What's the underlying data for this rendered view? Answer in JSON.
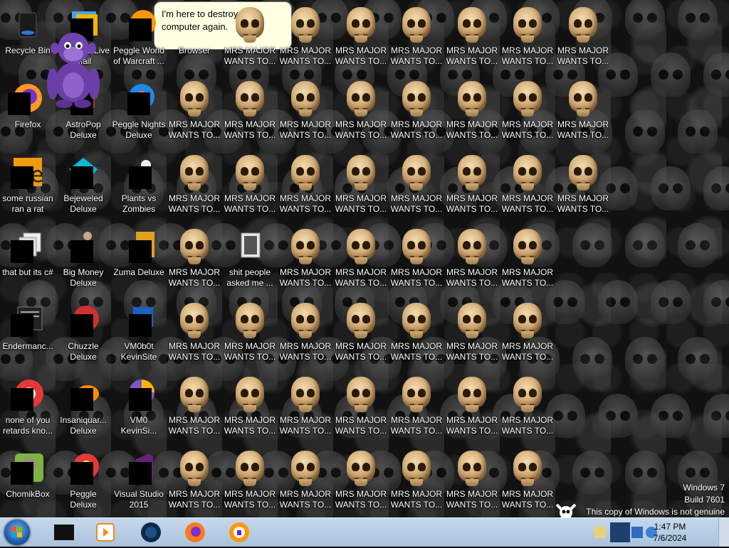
{
  "desktop": {
    "col1": [
      {
        "label": "Recycle Bin",
        "icon": "recycle-bin-icon"
      },
      {
        "label": "Firefox",
        "icon": "firefox-icon"
      },
      {
        "label": "some russian ran a rat",
        "icon": "app-e-icon"
      },
      {
        "label": "that but its c#",
        "icon": "documents-stack-icon"
      },
      {
        "label": "Endermanc...",
        "icon": "window-icon"
      },
      {
        "label": "none of you retards kno...",
        "icon": "chrome-icon"
      },
      {
        "label": "ChomikBox",
        "icon": "chomikbox-icon"
      }
    ],
    "col2": [
      {
        "label": "Windows Live Mail",
        "icon": "windows-live-mail-icon"
      },
      {
        "label": "AstroPop Deluxe",
        "icon": "astropop-icon"
      },
      {
        "label": "Bejeweled Deluxe",
        "icon": "bejeweled-icon"
      },
      {
        "label": "Big Money Deluxe",
        "icon": "big-money-icon"
      },
      {
        "label": "Chuzzle Deluxe",
        "icon": "chuzzle-icon"
      },
      {
        "label": "Insaniquar... Deluxe",
        "icon": "insaniquarium-icon"
      },
      {
        "label": "Peggle Deluxe",
        "icon": "peggle-icon"
      }
    ],
    "col3": [
      {
        "label": "Peggle World of Warcraft ...",
        "icon": "peggle-wow-icon"
      },
      {
        "label": "Peggle Nights Deluxe",
        "icon": "peggle-nights-icon"
      },
      {
        "label": "Plants vs Zombies",
        "icon": "plants-vs-zombies-icon"
      },
      {
        "label": "Zuma Deluxe",
        "icon": "zuma-icon"
      },
      {
        "label": "VM0b0t KevinSite",
        "icon": "vm0b0t-icon"
      },
      {
        "label": "VM0 KevinSi...",
        "icon": "vm0-icon"
      },
      {
        "label": "Visual Studio 2015",
        "icon": "visual-studio-icon"
      }
    ],
    "browser_label": "Browser",
    "skull_label": "MRS MAJOR WANTS TO...",
    "folder_label": "shit people asked me ...",
    "bubble_text": "I'm here to destroy your computer again."
  },
  "notice": {
    "line1": "Windows 7",
    "line2": "Build 7601",
    "line3": "This copy of Windows is not genuine"
  },
  "taskbar": {
    "time": "1:47 PM",
    "date": "7/6/2024",
    "pinned": [
      "explorer-icon",
      "media-player-icon",
      "globe-icon",
      "firefox-icon",
      "vpn-icon"
    ]
  },
  "colors": {
    "taskbar": "#b9cfe3",
    "bubble": "#ffffe1",
    "skull": "#d6b07a"
  }
}
